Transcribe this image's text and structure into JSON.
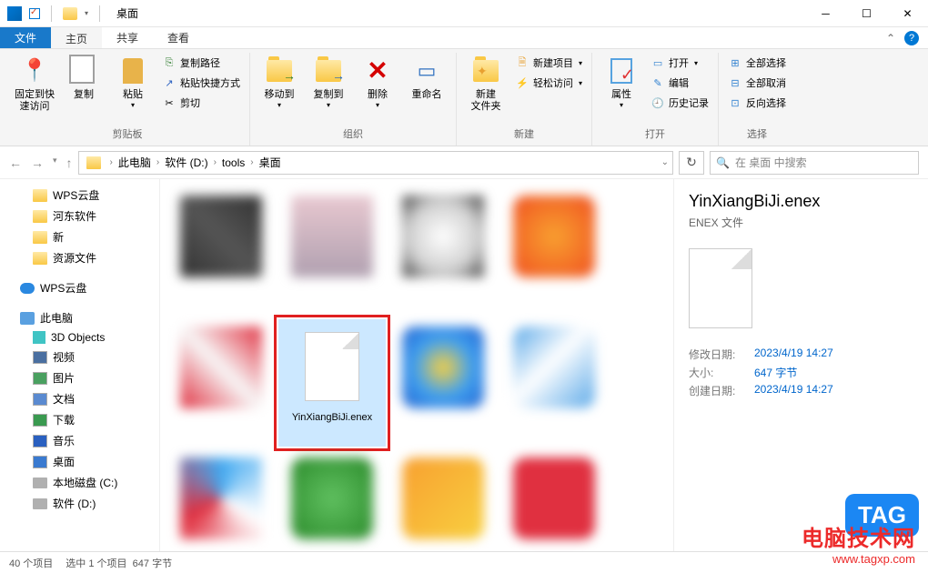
{
  "titlebar": {
    "title": "桌面"
  },
  "tabs": {
    "file": "文件",
    "home": "主页",
    "share": "共享",
    "view": "查看"
  },
  "ribbon": {
    "clipboard": {
      "label": "剪贴板",
      "pin": "固定到快\n速访问",
      "copy": "复制",
      "paste": "粘贴",
      "copy_path": "复制路径",
      "paste_shortcut": "粘贴快捷方式",
      "cut": "剪切"
    },
    "organize": {
      "label": "组织",
      "move_to": "移动到",
      "copy_to": "复制到",
      "delete": "删除",
      "rename": "重命名"
    },
    "new": {
      "label": "新建",
      "new_folder": "新建\n文件夹",
      "new_item": "新建项目",
      "easy_access": "轻松访问"
    },
    "open": {
      "label": "打开",
      "properties": "属性",
      "open": "打开",
      "edit": "编辑",
      "history": "历史记录"
    },
    "select": {
      "label": "选择",
      "select_all": "全部选择",
      "select_none": "全部取消",
      "invert": "反向选择"
    }
  },
  "breadcrumb": {
    "this_pc": "此电脑",
    "drive": "软件 (D:)",
    "folder1": "tools",
    "folder2": "桌面"
  },
  "search": {
    "placeholder": "在 桌面 中搜索"
  },
  "sidebar": {
    "items": [
      {
        "label": "WPS云盘",
        "icon": "folder",
        "lvl": 1
      },
      {
        "label": "河东软件",
        "icon": "folder",
        "lvl": 1
      },
      {
        "label": "新",
        "icon": "folder",
        "lvl": 1
      },
      {
        "label": "资源文件",
        "icon": "folder",
        "lvl": 1
      }
    ],
    "wps_cloud": "WPS云盘",
    "this_pc": "此电脑",
    "pc_items": [
      {
        "label": "3D Objects",
        "icon": "3d"
      },
      {
        "label": "视频",
        "icon": "generic"
      },
      {
        "label": "图片",
        "icon": "generic"
      },
      {
        "label": "文档",
        "icon": "generic"
      },
      {
        "label": "下载",
        "icon": "generic"
      },
      {
        "label": "音乐",
        "icon": "generic"
      },
      {
        "label": "桌面",
        "icon": "generic"
      },
      {
        "label": "本地磁盘 (C:)",
        "icon": "disk"
      },
      {
        "label": "软件 (D:)",
        "icon": "disk"
      }
    ]
  },
  "selected_file": {
    "name": "YinXiangBiJi.enex"
  },
  "preview": {
    "filename": "YinXiangBiJi.enex",
    "filetype": "ENEX 文件",
    "mod_label": "修改日期:",
    "mod_value": "2023/4/19 14:27",
    "size_label": "大小:",
    "size_value": "647 字节",
    "create_label": "创建日期:",
    "create_value": "2023/4/19 14:27"
  },
  "statusbar": {
    "count": "40 个项目",
    "selected": "选中 1 个项目",
    "size": "647 字节"
  },
  "watermark": {
    "line1": "电脑技术网",
    "line2": "www.tagxp.com",
    "tag": "TAG"
  }
}
